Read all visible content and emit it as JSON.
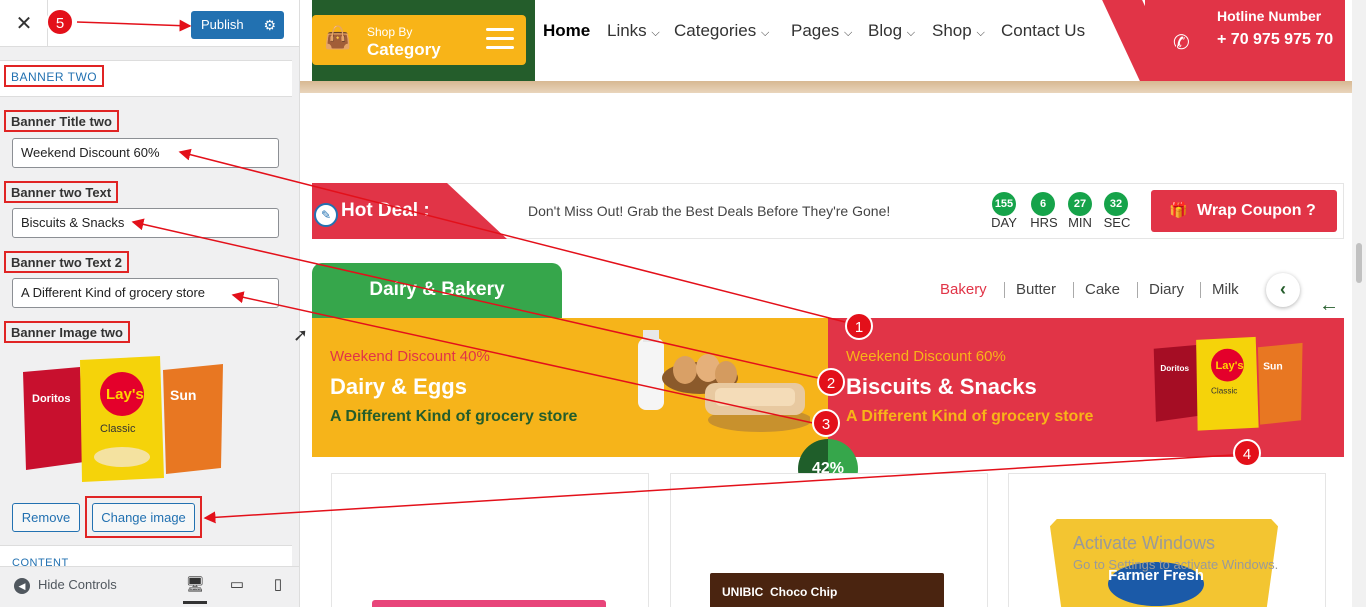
{
  "panel": {
    "close_icon": "close-icon",
    "publish_label": "Publish",
    "publish_gear_icon": "gear-icon",
    "section_title": "BANNER TWO",
    "fields": [
      {
        "label": "Banner Title two",
        "value": "Weekend Discount 60%"
      },
      {
        "label": "Banner two Text",
        "value": "Biscuits & Snacks"
      },
      {
        "label": "Banner two Text 2",
        "value": "A Different Kind of grocery store"
      }
    ],
    "image_label": "Banner Image two",
    "remove_label": "Remove",
    "change_image_label": "Change image",
    "next_section": "CONTENT",
    "hide_controls": "Hide Controls"
  },
  "header": {
    "shop_by": "Shop By",
    "category": "Category",
    "nav": [
      "Home",
      "Links",
      "Categories",
      "Pages",
      "Blog",
      "Shop",
      "Contact Us"
    ],
    "hotline_label": "Hotline Number",
    "hotline_number": "+ 70 975 975 70"
  },
  "deal": {
    "title": "Hot Deal :",
    "text": "Don't Miss Out! Grab the Best Deals Before They're Gone!",
    "countdown": [
      {
        "value": "155",
        "unit": "DAY"
      },
      {
        "value": "6",
        "unit": "HRS"
      },
      {
        "value": "27",
        "unit": "MIN"
      },
      {
        "value": "32",
        "unit": "SEC"
      }
    ],
    "coupon_label": "Wrap Coupon ?"
  },
  "category_tab": "Dairy & Bakery",
  "category_links": [
    "Bakery",
    "Butter",
    "Cake",
    "Diary",
    "Milk"
  ],
  "banners": {
    "one": {
      "discount": "Weekend Discount 40%",
      "title": "Dairy & Eggs",
      "text": "A Different Kind of grocery store"
    },
    "two": {
      "discount": "Weekend Discount 60%",
      "title": "Biscuits & Snacks",
      "text": "A Different Kind of grocery store"
    }
  },
  "progress_label": "42%",
  "progress_value": 0.42,
  "products": {
    "p2_brand": "UNIBIC",
    "p2_name": "Choco Chip",
    "p3_brand": "Farmer Fresh"
  },
  "watermark": {
    "line1": "Activate Windows",
    "line2": "Go to Settings to activate Windows."
  },
  "annotations": [
    "1",
    "2",
    "3",
    "4",
    "5"
  ],
  "colors": {
    "accent_red": "#e13447",
    "accent_green": "#245d2b",
    "wp_blue": "#2271b1",
    "banner_yellow": "#f6b41a"
  }
}
